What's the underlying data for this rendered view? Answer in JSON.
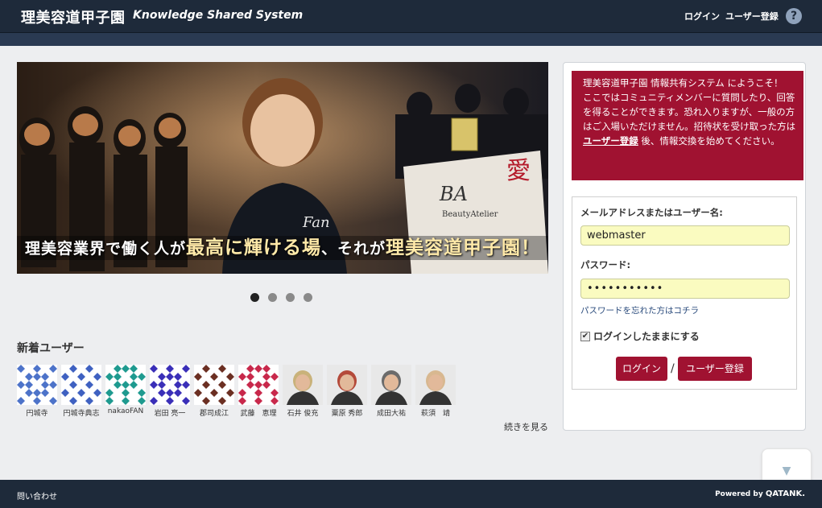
{
  "header": {
    "brand": "理美容道甲子園",
    "tagline": "Knowledge Shared System",
    "login_link": "ログイン",
    "register_link": "ユーザー登録",
    "help_icon": "?"
  },
  "carousel": {
    "caption_pre": "理美容業界で働く人が",
    "caption_hl": "最高に輝ける場",
    "caption_mid": "、それが",
    "caption_brand": "理美容道甲子園！",
    "slide_count": 4,
    "active_index": 0
  },
  "new_users": {
    "title": "新着ユーザー",
    "more_link": "続きを見る",
    "users": [
      {
        "name": "円城寺",
        "avatar": "identicon-blue",
        "color": "#4d73c9"
      },
      {
        "name": "円城寺典志",
        "avatar": "identicon-blue-diamond",
        "color": "#3f61c1"
      },
      {
        "name": "nakaoFAN",
        "avatar": "identicon-teal",
        "color": "#1e9a8f"
      },
      {
        "name": "岩田 亮一",
        "avatar": "identicon-indigo",
        "color": "#3a2fb8"
      },
      {
        "name": "郡司成江",
        "avatar": "identicon-brown",
        "color": "#6b2f22"
      },
      {
        "name": "武藤　恵理",
        "avatar": "identicon-crimson",
        "color": "#c8284b"
      },
      {
        "name": "石井 俊充",
        "avatar": "photo",
        "color": "#c9b27a"
      },
      {
        "name": "粟原 秀郎",
        "avatar": "photo",
        "color": "#b44a3a"
      },
      {
        "name": "成田大祐",
        "avatar": "photo",
        "color": "#6b6b6b"
      },
      {
        "name": "萩須　靖",
        "avatar": "photo",
        "color": "#d8b890"
      }
    ]
  },
  "panel": {
    "welcome_pre": "理美容道甲子園 情報共有システム にようこそ！　ここではコミュニティメンバーに質問したり、回答を得ることができます。恐れ入りますが、一般の方はご入場いただけません。招待状を受け取った方は ",
    "welcome_link": "ユーザー登録",
    "welcome_post": " 後、情報交換を始めてください。",
    "username_label": "メールアドレスまたはユーザー名:",
    "username_value": "webmaster",
    "password_label": "パスワード:",
    "password_value": "•••••••••••",
    "forgot_link": "パスワードを忘れた方はコチラ",
    "remember_label": "ログインしたままにする",
    "remember_checked": "✔",
    "login_button": "ログイン",
    "separator": "/",
    "register_button": "ユーザー登録"
  },
  "scroll_top_icon": "▼",
  "footer": {
    "contact": "問い合わせ",
    "powered_pre": "Powered by ",
    "powered_brand": "QATANK."
  },
  "colors": {
    "header_bg": "#1e2a3a",
    "accent": "#a01231",
    "input_bg": "#fafbc0"
  }
}
